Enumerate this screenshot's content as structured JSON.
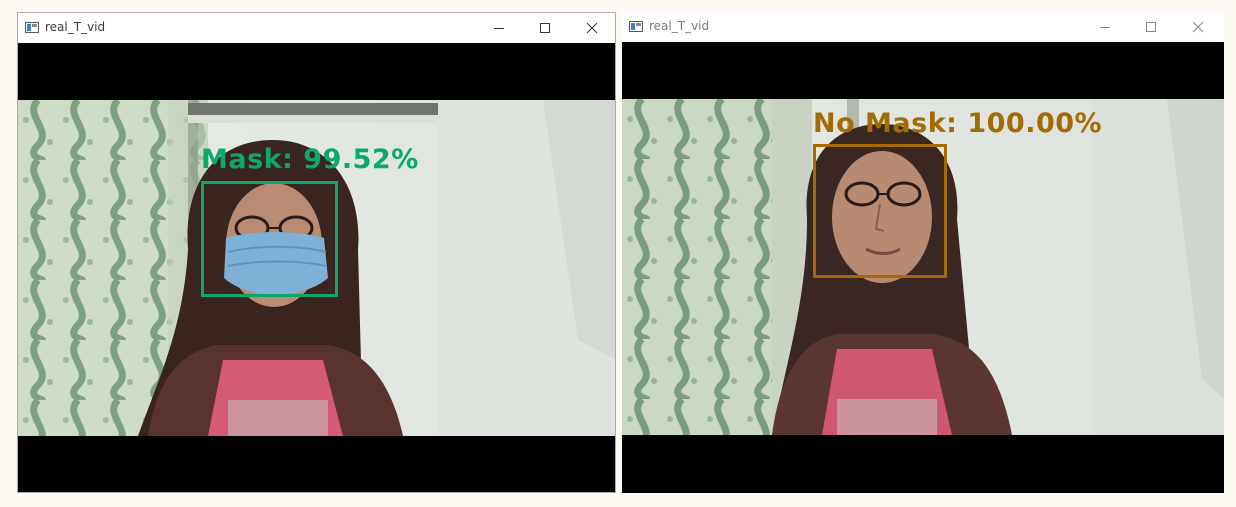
{
  "windows": [
    {
      "title": "real_T_vid",
      "detection": {
        "label": "Mask: 99.52%",
        "class": "Mask",
        "confidence": 99.52
      },
      "color": "#0aa86b"
    },
    {
      "title": "real_T_vid",
      "detection": {
        "label": "No Mask: 100.00%",
        "class": "No Mask",
        "confidence": 100.0
      },
      "color": "#a36a05"
    }
  ],
  "icons": {
    "app": "app-window-icon",
    "minimize": "minimize-icon",
    "maximize": "maximize-icon",
    "close": "close-icon"
  }
}
